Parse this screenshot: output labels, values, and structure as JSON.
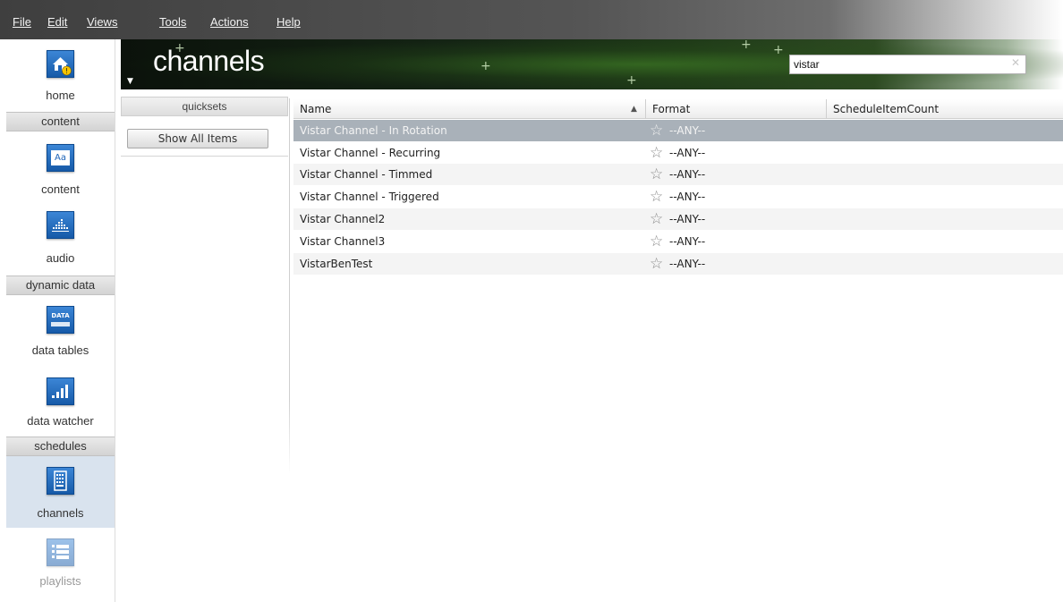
{
  "menu": [
    {
      "label": "File"
    },
    {
      "label": "Edit"
    },
    {
      "label": "Views"
    },
    {
      "label": "Tools"
    },
    {
      "label": "Actions"
    },
    {
      "label": "Help"
    }
  ],
  "sidebar": {
    "home_label": "home",
    "sections": {
      "content": "content",
      "dynamic": "dynamic data",
      "schedules": "schedules"
    },
    "items": {
      "content": "content",
      "content_icon_text": "Aa",
      "audio": "audio",
      "data_tables": "data tables",
      "data_tables_icon_text": "DATA",
      "data_watcher": "data watcher",
      "channels": "channels",
      "playlists": "playlists"
    }
  },
  "banner": {
    "title": "channels",
    "search_value": "vistar"
  },
  "quicksets": {
    "header": "quicksets",
    "show_all": "Show All Items"
  },
  "grid": {
    "columns": [
      "Name",
      "Format",
      "ScheduleItemCount"
    ],
    "sort_indicator": "▲",
    "rows": [
      {
        "name": "Vistar Channel - In Rotation",
        "format": "--ANY--"
      },
      {
        "name": "Vistar Channel - Recurring",
        "format": "--ANY--"
      },
      {
        "name": "Vistar Channel - Timmed",
        "format": "--ANY--"
      },
      {
        "name": "Vistar Channel - Triggered",
        "format": "--ANY--"
      },
      {
        "name": "Vistar Channel2",
        "format": "--ANY--"
      },
      {
        "name": "Vistar Channel3",
        "format": "--ANY--"
      },
      {
        "name": "VistarBenTest",
        "format": "--ANY--"
      }
    ],
    "selected_row": 0
  },
  "colors": {
    "selected_row": "#a9b1b9",
    "icon_blue": "#1f6cc2",
    "warning_badge": "#f5c400"
  }
}
